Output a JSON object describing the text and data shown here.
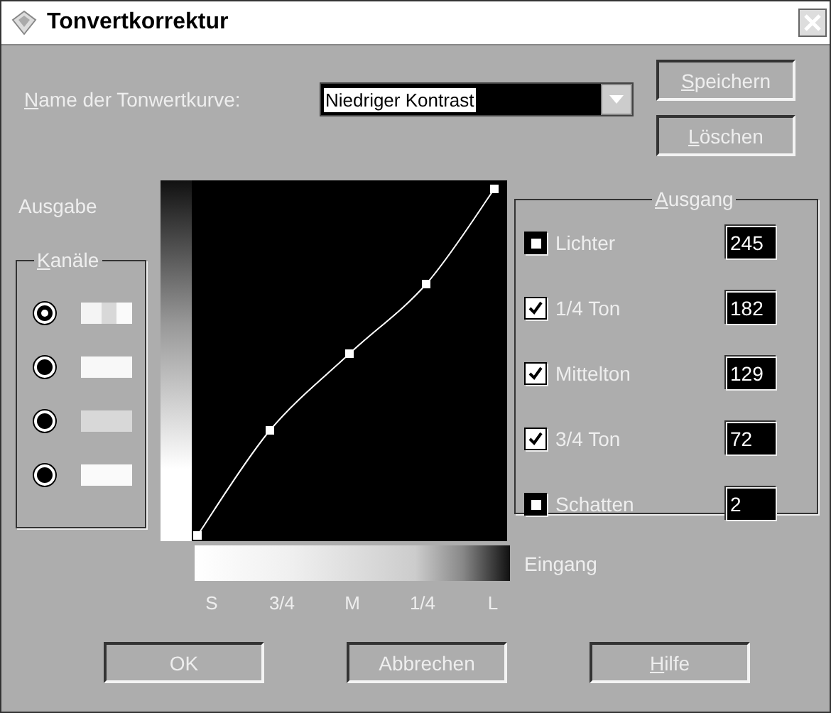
{
  "window": {
    "title": "Tonvertkorrektur"
  },
  "curve_name": {
    "label": "Name der Tonwertkurve:",
    "mnemonic": true,
    "value": "Niedriger Kontrast"
  },
  "side_buttons": [
    {
      "label": "Speichern",
      "mnemonic": true
    },
    {
      "label": "Löschen",
      "mnemonic": true
    }
  ],
  "output_label": "Ausgabe",
  "channels": {
    "title": "Kanäle",
    "mnemonic": true,
    "items": [
      {
        "selected": true,
        "kind": "composite"
      },
      {
        "selected": false,
        "kind": "single",
        "color": "#f8f8f8"
      },
      {
        "selected": false,
        "kind": "single",
        "color": "#d8d8d8"
      },
      {
        "selected": false,
        "kind": "single",
        "color": "#fafafa"
      }
    ]
  },
  "ausgang": {
    "title": "Ausgang",
    "mnemonic": true,
    "rows": [
      {
        "label": "Lichter",
        "kind": "fixed",
        "value": "245"
      },
      {
        "label": "1/4 Ton",
        "kind": "checkbox",
        "checked": true,
        "value": "182"
      },
      {
        "label": "Mittelton",
        "kind": "checkbox",
        "checked": true,
        "value": "129"
      },
      {
        "label": "3/4 Ton",
        "kind": "checkbox",
        "checked": true,
        "value": "72"
      },
      {
        "label": "Schatten",
        "kind": "fixed",
        "value": "2"
      }
    ]
  },
  "input_label": "Eingang",
  "input_ticks": [
    "S",
    "3/4",
    "M",
    "1/4",
    "L"
  ],
  "buttons": [
    {
      "label": "OK",
      "mnemonic": false
    },
    {
      "label": "Abbrechen",
      "mnemonic": false
    },
    {
      "label": "Hilfe",
      "mnemonic": true
    }
  ]
}
